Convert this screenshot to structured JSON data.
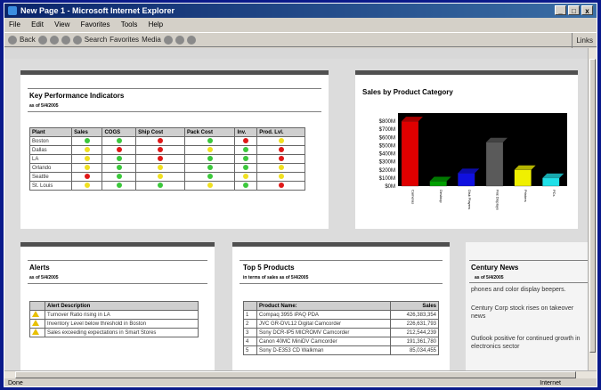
{
  "window": {
    "title": "New Page 1 - Microsoft Internet Explorer",
    "buttons": [
      "_",
      "□",
      "x"
    ]
  },
  "menu": [
    "File",
    "Edit",
    "View",
    "Favorites",
    "Tools",
    "Help"
  ],
  "toolbar": {
    "back": "Back",
    "search": "Search",
    "favorites": "Favorites",
    "media": "Media",
    "links": "Links"
  },
  "status": {
    "left": "Done",
    "zone": "Internet"
  },
  "kpi": {
    "title": "Key Performance Indicators",
    "asof": "as of 5/4/2005",
    "headers": [
      "Plant",
      "Sales",
      "COGS",
      "Ship Cost",
      "Pack Cost",
      "Inv.",
      "Prod. Lvl."
    ],
    "rows": [
      {
        "plant": "Boston",
        "status": [
          "green",
          "green",
          "red",
          "green",
          "red",
          "yellow"
        ]
      },
      {
        "plant": "Dallas",
        "status": [
          "yellow",
          "red",
          "red",
          "yellow",
          "green",
          "red"
        ]
      },
      {
        "plant": "LA",
        "status": [
          "yellow",
          "green",
          "red",
          "green",
          "green",
          "red"
        ]
      },
      {
        "plant": "Orlando",
        "status": [
          "yellow",
          "green",
          "yellow",
          "green",
          "green",
          "yellow"
        ]
      },
      {
        "plant": "Seattle",
        "status": [
          "red",
          "green",
          "yellow",
          "green",
          "yellow",
          "yellow"
        ]
      },
      {
        "plant": "St. Louis",
        "status": [
          "yellow",
          "green",
          "green",
          "yellow",
          "green",
          "red"
        ]
      }
    ]
  },
  "colors": {
    "green": "#3cc83c",
    "yellow": "#f0e020",
    "red": "#e01818"
  },
  "chart_data": {
    "type": "bar",
    "title": "Sales by Product Category",
    "categories": [
      "Cameras",
      "Desktop",
      "Disk Players",
      "Flat Displays",
      "Printers",
      "PCs"
    ],
    "values": [
      800,
      60,
      160,
      540,
      200,
      100
    ],
    "ylim": [
      0,
      900
    ],
    "yticks": [
      "$0M",
      "$100M",
      "$200M",
      "$300M",
      "$400M",
      "$500M",
      "$600M",
      "$700M",
      "$800M"
    ],
    "colors": [
      "#e00000",
      "#00a000",
      "#1010e0",
      "#5a5a5a",
      "#f0f000",
      "#20e0e8"
    ],
    "background": "#000000"
  },
  "alerts": {
    "title": "Alerts",
    "asof": "as of 5/4/2005",
    "header": "Alert Description",
    "items": [
      "Turnover Ratio rising in LA",
      "Inventory Level below threshold in Boston",
      "Sales exceeding expectations in Smart Stores"
    ]
  },
  "top5": {
    "title": "Top 5 Products",
    "subtitle": "in terms of sales as of 5/4/2005",
    "headers": [
      "",
      "Product Name:",
      "Sales"
    ],
    "rows": [
      {
        "n": "1",
        "name": "Compaq 3955 iPAQ PDA",
        "sales": "426,383,354"
      },
      {
        "n": "2",
        "name": "JVC GR-DVL12 Digital Camcorder",
        "sales": "226,631,793"
      },
      {
        "n": "3",
        "name": "Sony DCR-IP5 MICROMV Camcorder",
        "sales": "212,544,239"
      },
      {
        "n": "4",
        "name": "Canon 40MC MiniDV Camcorder",
        "sales": "191,361,780"
      },
      {
        "n": "5",
        "name": "Sony D-E353 CD Walkman",
        "sales": "85,034,455"
      }
    ]
  },
  "news": {
    "title": "Century News",
    "asof": "as of 5/4/2005",
    "items": [
      "phones and color display beepers.",
      "Century Corp stock rises on takeover news",
      "Outlook positive for continued growth in electronics sector"
    ]
  }
}
